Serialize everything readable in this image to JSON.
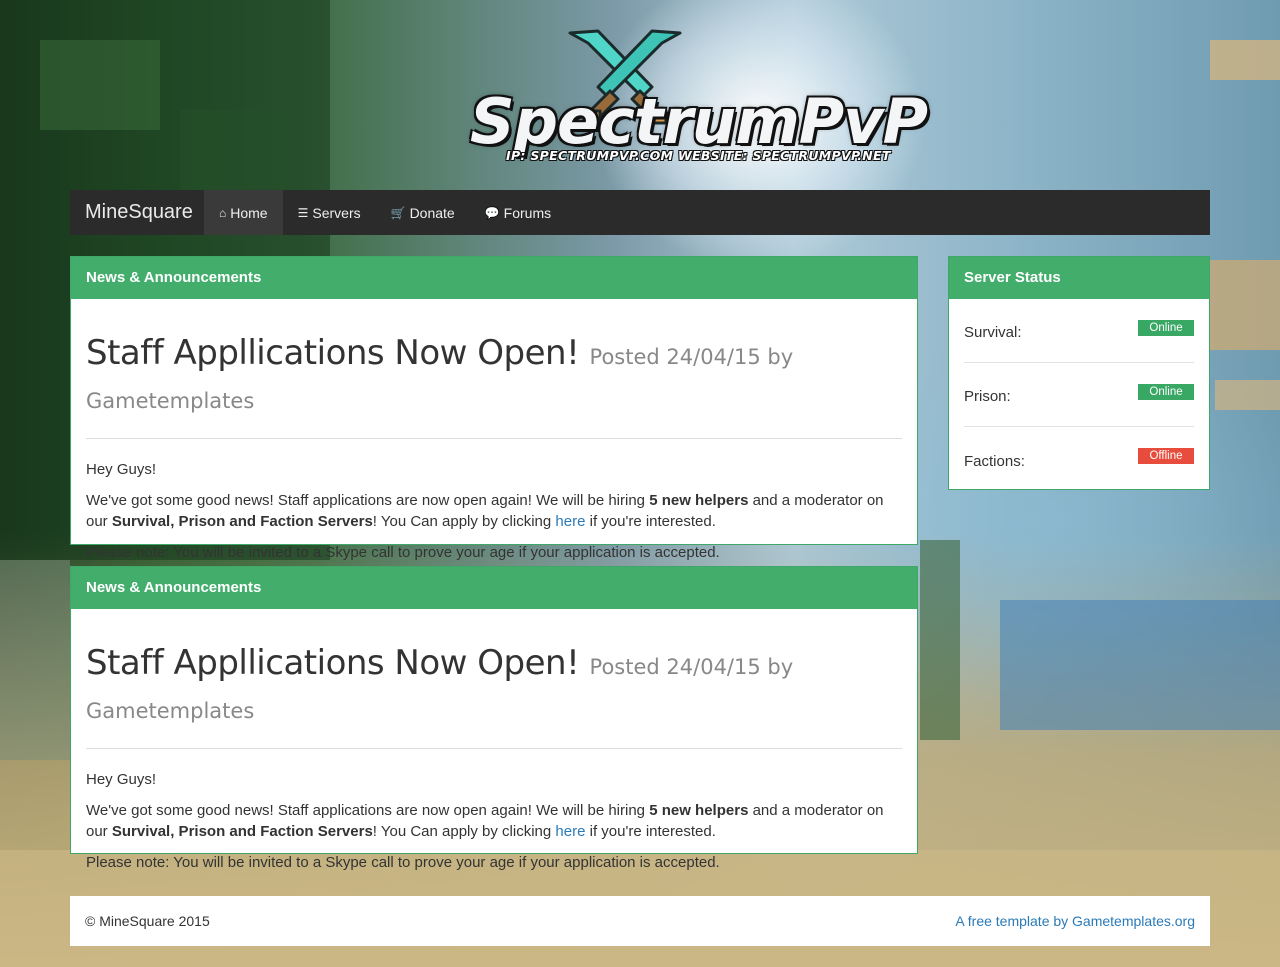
{
  "logo": {
    "title": "SpectrumPvP",
    "subtitle": "IP: SPECTRUMPVP.COM WEBSITE: SPECTRUMPVP.NET"
  },
  "navbar": {
    "brand": "MineSquare",
    "items": [
      {
        "label": "Home",
        "icon": "home-icon",
        "active": true
      },
      {
        "label": "Servers",
        "icon": "list-icon",
        "active": false
      },
      {
        "label": "Donate",
        "icon": "cart-icon",
        "active": false
      },
      {
        "label": "Forums",
        "icon": "comments-icon",
        "active": false
      }
    ]
  },
  "posts": [
    {
      "heading": "News & Announcements",
      "title": "Staff Appllications Now Open!",
      "meta": "Posted 24/04/15 by Gametemplates",
      "greeting": "Hey Guys!",
      "p1_a": "We've got some good news! Staff applications are now open again! We will be hiring ",
      "p1_b": "5 new helpers",
      "p1_c": " and a moderator on our ",
      "p1_d": "Survival, Prison and Faction Servers",
      "p1_e": "! You Can apply by clicking ",
      "p1_link": "here",
      "p1_f": " if you're interested.",
      "note": "Please note: You will be invited to a Skype call to prove your age if your application is accepted."
    },
    {
      "heading": "News & Announcements",
      "title": "Staff Appllications Now Open!",
      "meta": "Posted 24/04/15 by Gametemplates",
      "greeting": "Hey Guys!",
      "p1_a": "We've got some good news! Staff applications are now open again! We will be hiring ",
      "p1_b": "5 new helpers",
      "p1_c": " and a moderator on our ",
      "p1_d": "Survival, Prison and Faction Servers",
      "p1_e": "! You Can apply by clicking ",
      "p1_link": "here",
      "p1_f": " if you're interested.",
      "note": "Please note: You will be invited to a Skype call to prove your age if your application is accepted."
    }
  ],
  "server_status": {
    "heading": "Server Status",
    "servers": [
      {
        "name": "Survival:",
        "status": "Online",
        "color": "#3aa865"
      },
      {
        "name": "Prison:",
        "status": "Online",
        "color": "#3aa865"
      },
      {
        "name": "Factions:",
        "status": "Offline",
        "color": "#e74c3c"
      }
    ]
  },
  "footer": {
    "copyright": "© MineSquare 2015",
    "credit": "A free template by Gametemplates.org"
  }
}
